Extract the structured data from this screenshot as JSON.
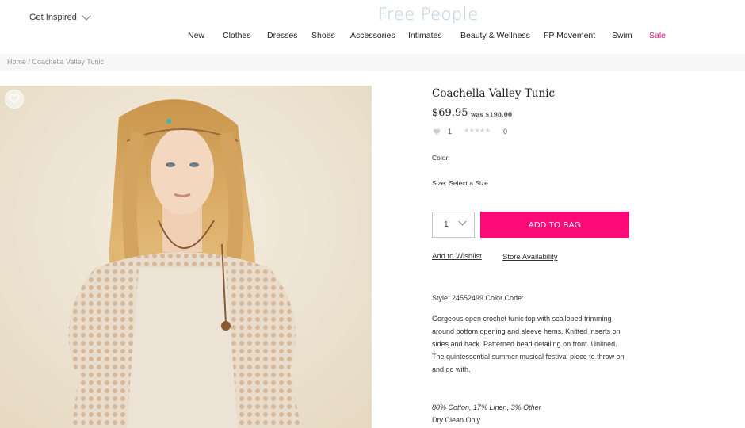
{
  "header": {
    "get_inspired": "Get Inspired",
    "logo": "Free People",
    "nav": [
      {
        "label": "New"
      },
      {
        "label": "Clothes"
      },
      {
        "label": "Dresses"
      },
      {
        "label": "Shoes"
      },
      {
        "label": "Accessories"
      },
      {
        "label": "Intimates"
      },
      {
        "label": "Beauty & Wellness"
      },
      {
        "label": "FP Movement"
      },
      {
        "label": "Swim"
      },
      {
        "label": "Sale"
      }
    ]
  },
  "breadcrumb": {
    "home": "Home",
    "separator": " / ",
    "current": "Coachella Valley Tunic"
  },
  "product": {
    "title": "Coachella Valley Tunic",
    "price": "$69.95",
    "was_price": "was $198.00",
    "likes": "1",
    "review_count": "0",
    "color_label": "Color:",
    "size_label": "Size: Select a Size",
    "quantity": "1",
    "add_to_bag": "ADD TO BAG",
    "add_to_wishlist": "Add to Wishlist",
    "store_availability": "Store Availability",
    "style_code": "Style: 24552499 Color Code:",
    "description": "Gorgeous open crochet tunic top with scalloped trimming around bottom opening and sleeve hems. Knitted inserts on sides and back. Patterned bead detailing on front. Unlined. The quintessential summer musical festival piece to throw on and go with.",
    "material": "80% Cotton, 17% Linen, 3% Other",
    "care": "Dry Clean Only"
  },
  "colors": {
    "accent": "#ff0a78",
    "sale": "#e8127c",
    "logo": "#b9cfe0",
    "photo_bg": "#efe6d6"
  },
  "icons": {
    "wishlist": "heart-icon",
    "dropdown": "chevron-down-icon",
    "likes": "heart-icon",
    "rating": "star-icon"
  }
}
